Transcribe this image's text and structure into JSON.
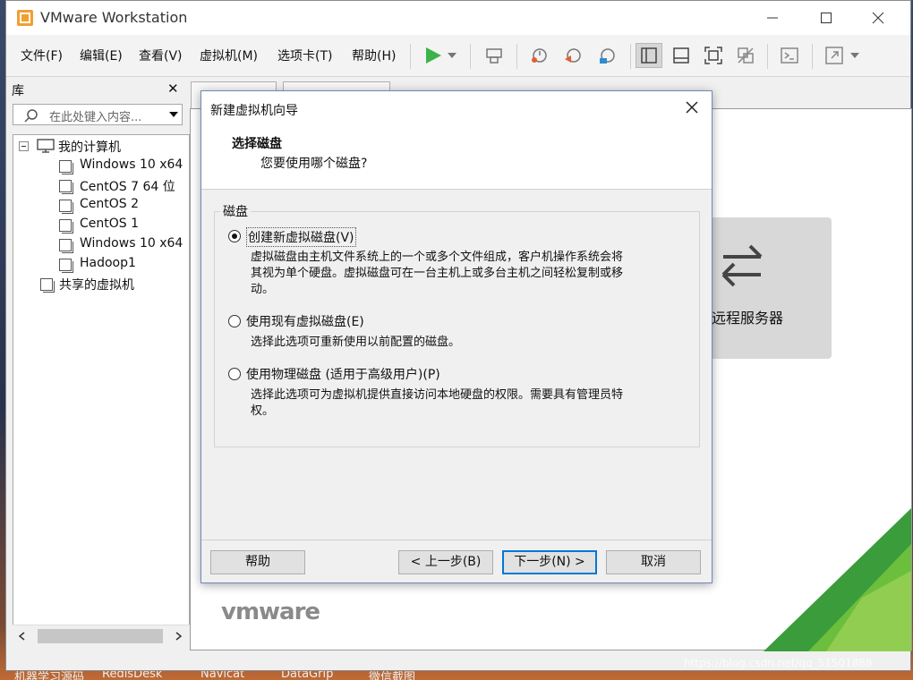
{
  "app": {
    "title": "VMware Workstation",
    "minimize": "—",
    "maximize": "☐",
    "close": "✕"
  },
  "menu": [
    "文件(F)",
    "编辑(E)",
    "查看(V)",
    "虚拟机(M)",
    "选项卡(T)",
    "帮助(H)"
  ],
  "library": {
    "title": "库",
    "close": "✕",
    "search_placeholder": "在此处键入内容...",
    "root": "我的计算机",
    "vms": [
      "Windows 10 x64",
      "CentOS 7 64 位",
      "CentOS 2",
      "CentOS 1",
      "Windows 10 x64",
      "Hadoop1"
    ],
    "shared": "共享的虚拟机"
  },
  "home": {
    "remote_label": "远程服务器",
    "brand": "vmware"
  },
  "dialog": {
    "title": "新建虚拟机向导",
    "heading": "选择磁盘",
    "subheading": "您要使用哪个磁盘?",
    "group_label": "磁盘",
    "options": [
      {
        "label": "创建新虚拟磁盘(V)",
        "desc1": "虚拟磁盘由主机文件系统上的一个或多个文件组成，客户机操作系统会将",
        "desc2": "其视为单个硬盘。虚拟磁盘可在一台主机上或多台主机之间轻松复制或移",
        "desc3": "动。",
        "selected": true
      },
      {
        "label": "使用现有虚拟磁盘(E)",
        "desc1": "选择此选项可重新使用以前配置的磁盘。",
        "selected": false
      },
      {
        "label": "使用物理磁盘 (适用于高级用户)(P)",
        "desc1": "选择此选项可为虚拟机提供直接访问本地硬盘的权限。需要具有管理员特",
        "desc2": "权。",
        "selected": false
      }
    ],
    "buttons": {
      "help": "帮助",
      "back": "< 上一步(B)",
      "next": "下一步(N) >",
      "cancel": "取消"
    }
  },
  "taskbar": [
    "机器学习源码",
    "RedisDesk",
    "Navicat",
    "DataGrip",
    "微信截图"
  ],
  "watermark": "https://blog.csdn.net/qq_51501888"
}
